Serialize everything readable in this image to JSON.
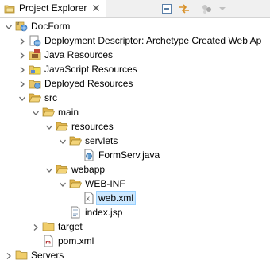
{
  "view": {
    "title": "Project Explorer",
    "close_symbol": "✖"
  },
  "toolbar": {
    "buttons": [
      "collapse-all-icon",
      "link-with-editor-icon",
      "filter-icon",
      "view-menu-icon"
    ]
  },
  "tree": [
    {
      "label": "DocForm",
      "state": "expanded",
      "icon": "web-project-icon"
    },
    {
      "label": "Deployment Descriptor: Archetype Created Web Ap",
      "state": "collapsed",
      "icon": "deployment-descriptor-icon"
    },
    {
      "label": "Java Resources",
      "state": "collapsed",
      "icon": "java-resources-icon"
    },
    {
      "label": "JavaScript Resources",
      "state": "collapsed",
      "icon": "javascript-resources-icon"
    },
    {
      "label": "Deployed Resources",
      "state": "collapsed",
      "icon": "deployed-resources-icon"
    },
    {
      "label": "src",
      "state": "expanded",
      "icon": "folder-open-icon"
    },
    {
      "label": "main",
      "state": "expanded",
      "icon": "folder-open-icon"
    },
    {
      "label": "resources",
      "state": "expanded",
      "icon": "folder-open-icon"
    },
    {
      "label": "servlets",
      "state": "expanded",
      "icon": "folder-open-icon"
    },
    {
      "label": "FormServ.java",
      "state": "leaf",
      "icon": "java-file-icon"
    },
    {
      "label": "webapp",
      "state": "expanded",
      "icon": "folder-open-icon"
    },
    {
      "label": "WEB-INF",
      "state": "expanded",
      "icon": "folder-open-icon"
    },
    {
      "label": "web.xml",
      "state": "leaf",
      "icon": "xml-file-icon",
      "selected": true
    },
    {
      "label": "index.jsp",
      "state": "leaf",
      "icon": "jsp-file-icon"
    },
    {
      "label": "target",
      "state": "collapsed",
      "icon": "folder-icon"
    },
    {
      "label": "pom.xml",
      "state": "leaf",
      "icon": "maven-pom-icon"
    },
    {
      "label": "Servers",
      "state": "collapsed",
      "icon": "folder-icon"
    }
  ]
}
